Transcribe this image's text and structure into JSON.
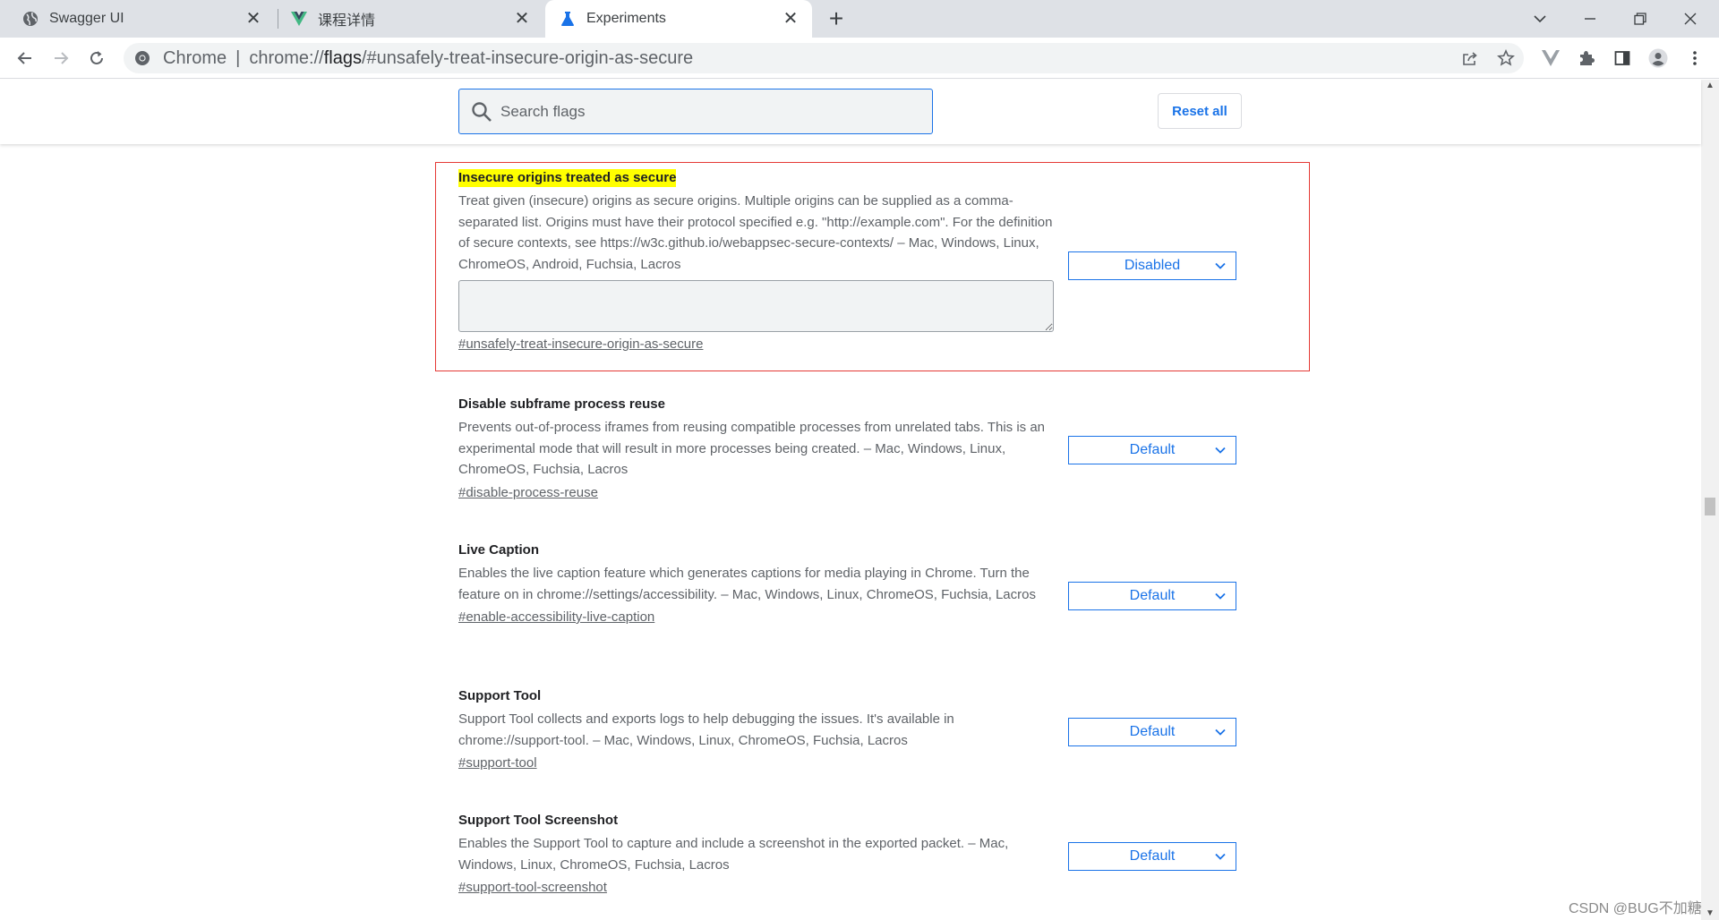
{
  "tabs": [
    {
      "title": "Swagger UI",
      "icon": "globe-icon",
      "active": false
    },
    {
      "title": "课程详情",
      "icon": "vue-logo-icon",
      "active": false
    },
    {
      "title": "Experiments",
      "icon": "flask-icon",
      "active": true
    }
  ],
  "omnibox": {
    "origin": "Chrome",
    "url_prefix": "chrome://",
    "url_host": "flags",
    "url_rest": "/#unsafely-treat-insecure-origin-as-secure"
  },
  "search": {
    "placeholder": "Search flags"
  },
  "reset_label": "Reset all",
  "flags": [
    {
      "title": "Insecure origins treated as secure",
      "description": "Treat given (insecure) origins as secure origins. Multiple origins can be supplied as a comma-separated list. Origins must have their protocol specified e.g. \"http://example.com\". For the definition of secure contexts, see https://w3c.github.io/webappsec-secure-contexts/ – Mac, Windows, Linux, ChromeOS, Android, Fuchsia, Lacros",
      "anchor": "#unsafely-treat-insecure-origin-as-secure",
      "value": "Disabled"
    },
    {
      "title": "Disable subframe process reuse",
      "description": "Prevents out-of-process iframes from reusing compatible processes from unrelated tabs. This is an experimental mode that will result in more processes being created. – Mac, Windows, Linux, ChromeOS, Fuchsia, Lacros",
      "anchor": "#disable-process-reuse",
      "value": "Default"
    },
    {
      "title": "Live Caption",
      "description": "Enables the live caption feature which generates captions for media playing in Chrome. Turn the feature on in chrome://settings/accessibility. – Mac, Windows, Linux, ChromeOS, Fuchsia, Lacros",
      "anchor": "#enable-accessibility-live-caption",
      "value": "Default"
    },
    {
      "title": "Support Tool",
      "description": "Support Tool collects and exports logs to help debugging the issues. It's available in chrome://support-tool. – Mac, Windows, Linux, ChromeOS, Fuchsia, Lacros",
      "anchor": "#support-tool",
      "value": "Default"
    },
    {
      "title": "Support Tool Screenshot",
      "description": "Enables the Support Tool to capture and include a screenshot in the exported packet. – Mac, Windows, Linux, ChromeOS, Fuchsia, Lacros",
      "anchor": "#support-tool-screenshot",
      "value": "Default"
    }
  ],
  "watermark": "CSDN @BUG不加糖",
  "colors": {
    "accent": "#1a73e8",
    "highlight": "#ffff00",
    "annotation_box": "#e53935",
    "tabstrip": "#dee1e6"
  }
}
